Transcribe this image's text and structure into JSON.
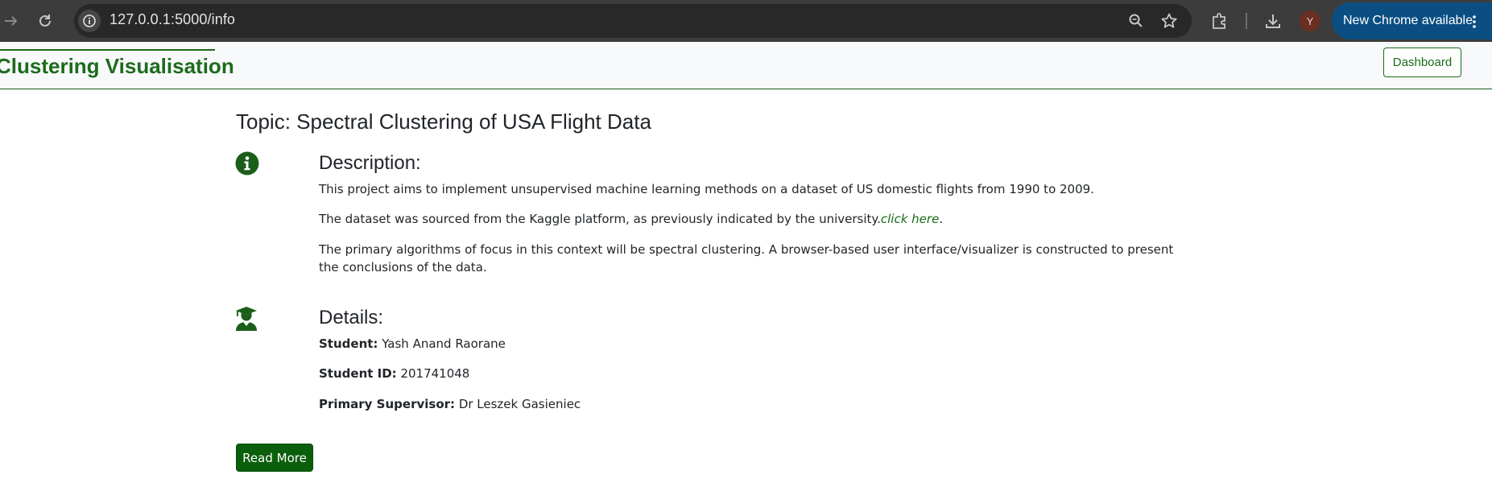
{
  "browser": {
    "url": "127.0.0.1:5000/info",
    "avatar_initial": "Y",
    "update_label": "New Chrome available",
    "icons": [
      "forward-icon",
      "reload-icon",
      "site-info-icon",
      "zoom-icon",
      "bookmark-star-icon",
      "extensions-icon",
      "download-icon",
      "more-menu-icon"
    ]
  },
  "navbar": {
    "brand": "Clustering Visualisation",
    "dashboard_label": "Dashboard"
  },
  "page": {
    "topic": "Topic: Spectral Clustering of USA Flight Data",
    "description": {
      "heading": "Description:",
      "p1": "This project aims to implement unsupervised machine learning methods on a dataset of US domestic flights from 1990 to 2009.",
      "p2_text": "The dataset was sourced from the Kaggle platform, as previously indicated by the university.",
      "p2_link": "click here",
      "p2_end": ".",
      "p3": "The primary algorithms of focus in this context will be spectral clustering. A browser-based user interface/visualizer is constructed to present the conclusions of the data."
    },
    "details": {
      "heading": "Details:",
      "student_label": "Student:",
      "student_value": "Yash Anand Raorane",
      "id_label": "Student ID:",
      "id_value": "201741048",
      "supervisor_label": "Primary Supervisor:",
      "supervisor_value": "Dr Leszek Gasieniec"
    },
    "read_more_label": "Read More"
  },
  "colors": {
    "accent": "#1a6b1a",
    "button": "#0b5e0b",
    "chrome_bg": "#3c3c3c",
    "update_pill": "#0b4f82"
  }
}
